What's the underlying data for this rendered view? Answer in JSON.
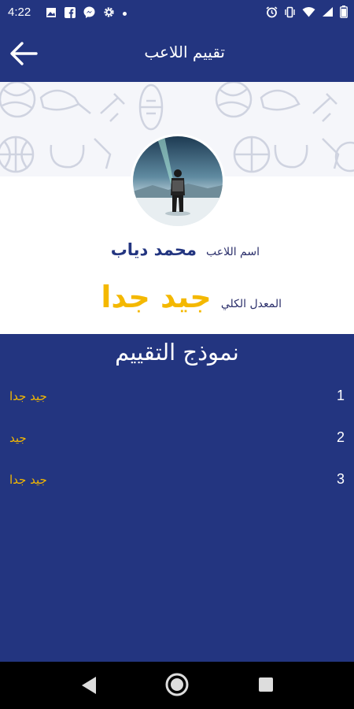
{
  "status_bar": {
    "time": "4:22",
    "left_icons": [
      "image-icon",
      "facebook-icon",
      "messenger-icon",
      "settings-icon",
      "dot-icon"
    ],
    "right_icons": [
      "alarm-icon",
      "vibrate-icon",
      "wifi-icon",
      "signal-icon",
      "battery-icon"
    ]
  },
  "app_bar": {
    "title": "تقييم اللاعب",
    "back_icon": "arrow-left-icon"
  },
  "player": {
    "name_label": "اسم اللاعب",
    "name": "محمد دياب",
    "average_label": "المعدل الكلي",
    "average_value": "جيد جدا"
  },
  "evaluation": {
    "title": "نموذج التقييم",
    "items": [
      {
        "number": "1",
        "value": "جيد جدا"
      },
      {
        "number": "2",
        "value": "جيد"
      },
      {
        "number": "3",
        "value": "جيد جدا"
      }
    ]
  },
  "colors": {
    "primary": "#233580",
    "accent": "#f4b800",
    "background": "#ffffff"
  }
}
